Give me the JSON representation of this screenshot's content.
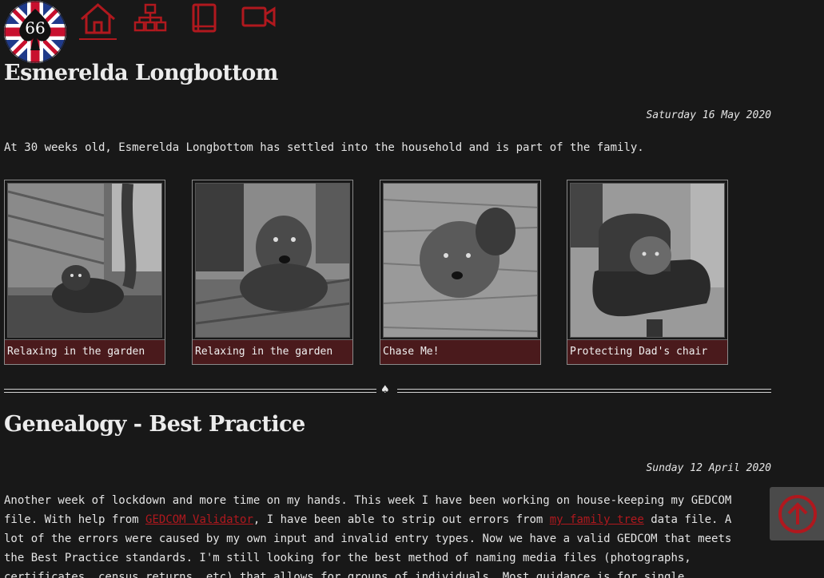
{
  "nav": {
    "logo_text": "66",
    "items": [
      {
        "name": "home-icon"
      },
      {
        "name": "sitemap-icon"
      },
      {
        "name": "book-icon"
      },
      {
        "name": "video-icon"
      }
    ],
    "accent": "#b0181e"
  },
  "posts": [
    {
      "title": "Esmerelda Longbottom",
      "date": "Saturday 16 May 2020",
      "text": "At 30 weeks old, Esmerelda Longbottom has settled into the household and is part of the family.",
      "gallery": [
        {
          "caption": "Relaxing in the garden"
        },
        {
          "caption": "Relaxing in the garden"
        },
        {
          "caption": "Chase Me!"
        },
        {
          "caption": "Protecting Dad's chair"
        }
      ]
    },
    {
      "title": "Genealogy - Best Practice",
      "date": "Sunday 12 April 2020",
      "text_parts": {
        "p1": "Another week of lockdown and more time on my hands. This week I have been working on house-keeping my GEDCOM file. With help from ",
        "link1": "GEDCOM Validator",
        "p2": ", I have been able to strip out errors from ",
        "link2": "my family tree",
        "p3": " data file. A lot of the errors were caused by my own input and invalid entry types. Now we have a valid GEDCOM that meets the Best Practice standards. I'm still looking for the best method of naming media files (photographs, certificates, census returns, etc) that allows for groups of individuals. Most guidance is for single individuals."
      }
    }
  ],
  "divider_glyph": "♠",
  "back_to_top_icon": "arrow-up-circle-icon"
}
